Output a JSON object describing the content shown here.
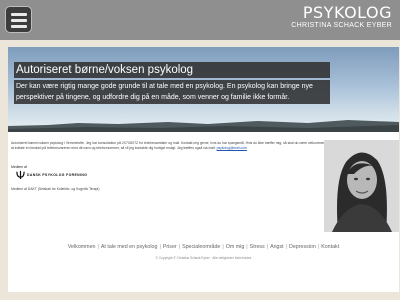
{
  "header": {
    "brand_title": "PSYKOLOG",
    "brand_subtitle": "CHRISTINA SCHACK EYBER",
    "menu_icon": "hamburger-menu-icon"
  },
  "hero": {
    "title": "Autoriseret børne/voksen psykolog",
    "text": "Der kan være rigtig mange gode grunde til at tale med en psykolog. En psykolog kan bringe nye perspektiver på tingene, og udfordre dig på en måde, som venner og familie ikke formår."
  },
  "intro": {
    "text": "Autoriseret børne/voksen psykolog i Vemmetofte. Jeg har konsultation på 2X7X8X7Z for telefonsamtaler og mail. Kontakt mig gerne, hvis du har spørgsmål. Hvis du ikke træffer mig, så skal du være velkommen til at indtale en besked på telefonsvareren med dit navn og telefonnummer, så vil jeg kontakte dig hurtigst muligt. Jeg træffes også via mail:",
    "email": "psykolog@mail.com"
  },
  "membership": {
    "small_label": "Medlem af",
    "org_name": "DANSK PSYKOLOG FORENING",
    "text": "Medlem af DAKT (Selskab for Kollektiv- og Kognitiv Terapi)"
  },
  "photo": {
    "alt": "Christina Schack Eyber portrait"
  },
  "footer": {
    "nav": [
      "Velkommen",
      "At tale med en psykolog",
      "Priser",
      "Specialeområde",
      "Om mig",
      "Stress",
      "Angst",
      "Depression",
      "Kontakt"
    ],
    "copyright": "© Copyright © Christina Schack Eyber · Alle rettigheder forbeholdes"
  }
}
